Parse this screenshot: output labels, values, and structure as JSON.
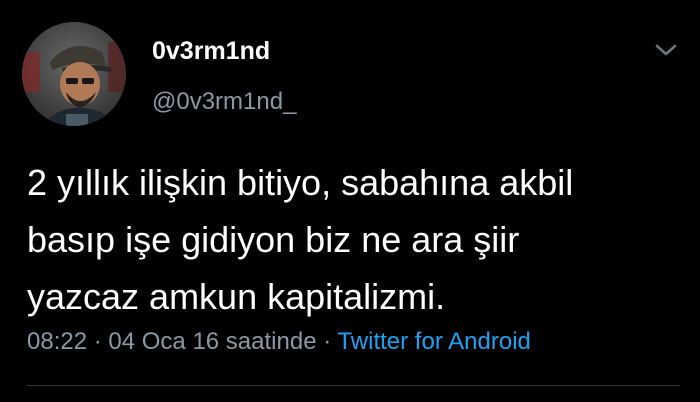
{
  "author": {
    "display_name": "0v3rm1nd",
    "handle": "@0v3rm1nd_",
    "avatar_icon": "profile-photo"
  },
  "tweet": {
    "lines": [
      "2 yıllık ilişkin bitiyo, sabahına akbil",
      "basıp işe gidiyon biz ne ara şiir",
      "yazcaz amkun kapitalizmi."
    ]
  },
  "meta": {
    "time": "08:22",
    "separator1": " · ",
    "date": "04 Oca 16 saatinde",
    "separator2": " · ",
    "source": "Twitter for Android"
  },
  "menu": {
    "icon": "chevron-down-icon"
  },
  "colors": {
    "background": "#000000",
    "text": "#ffffff",
    "secondary": "#8b98a5",
    "link": "#1da1f2",
    "divider": "#2f3336"
  }
}
